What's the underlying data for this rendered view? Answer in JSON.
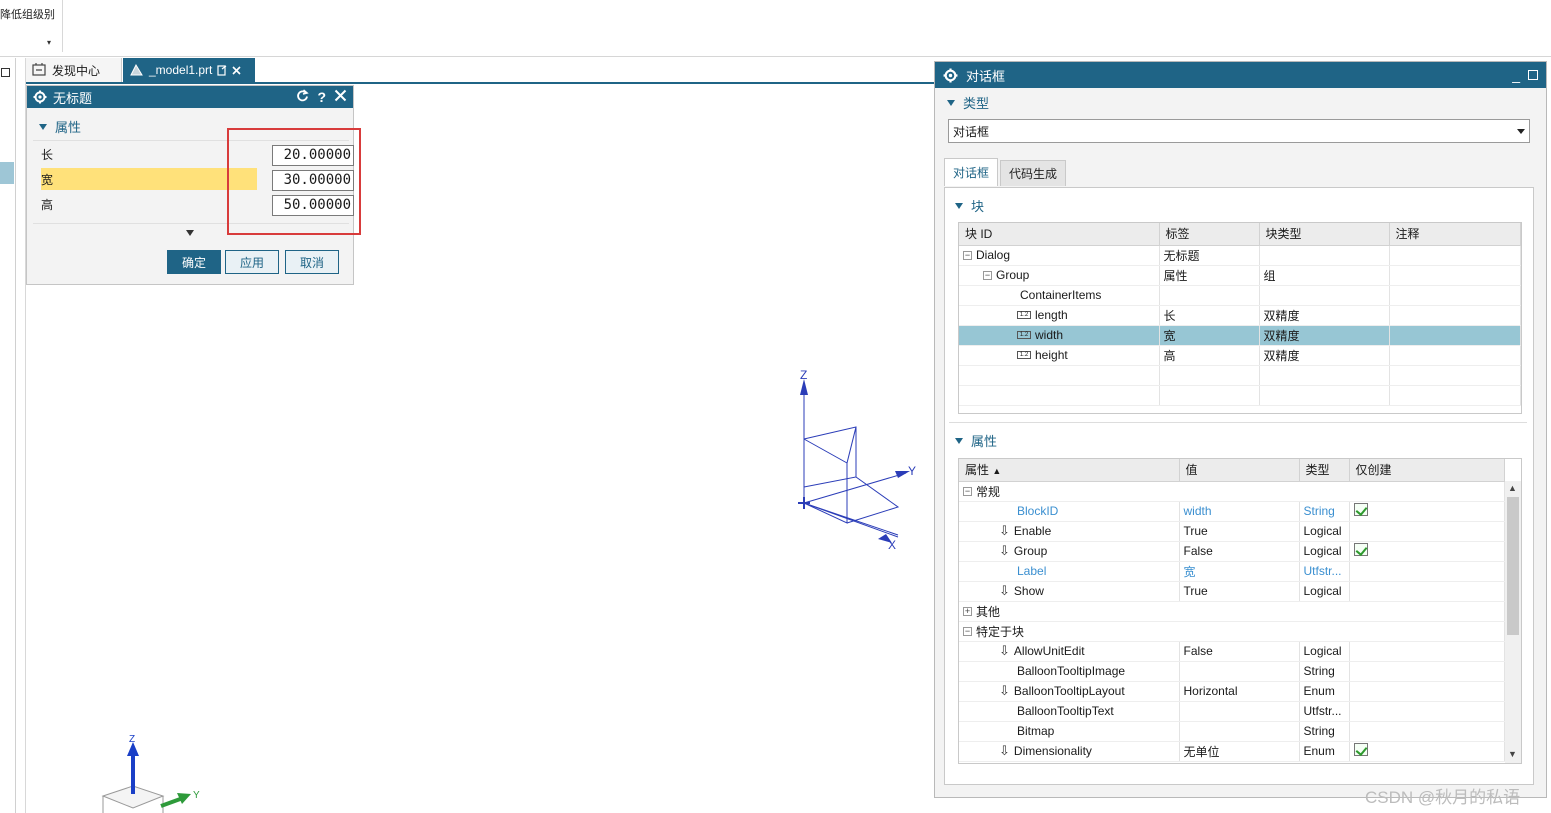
{
  "ribbon": {
    "command_label": "降低组级别",
    "dropdown_glyph": "▾"
  },
  "tabs": [
    {
      "label": "发现中心"
    },
    {
      "label": "_model1.prt"
    }
  ],
  "small_dialog": {
    "title": "无标题",
    "section": "属性",
    "rows": [
      {
        "label": "长",
        "value": "20.00000"
      },
      {
        "label": "宽",
        "value": "30.00000"
      },
      {
        "label": "高",
        "value": "50.00000"
      }
    ],
    "buttons": {
      "ok": "确定",
      "apply": "应用",
      "cancel": "取消"
    }
  },
  "big_dialog": {
    "title": "对话框",
    "type_section": "类型",
    "type_value": "对话框",
    "tabs": {
      "dialog": "对话框",
      "codegen": "代码生成"
    },
    "block_section": "块",
    "block_headers": {
      "id": "块 ID",
      "label": "标签",
      "type": "块类型",
      "note": "注释"
    },
    "block_rows": [
      {
        "id": "Dialog",
        "label": "无标题",
        "type": "",
        "note": ""
      },
      {
        "id": "Group",
        "label": "属性",
        "type": "组",
        "note": ""
      },
      {
        "id": "ContainerItems",
        "label": "",
        "type": "",
        "note": ""
      },
      {
        "id": "length",
        "label": "长",
        "type": "双精度",
        "note": ""
      },
      {
        "id": "width",
        "label": "宽",
        "type": "双精度",
        "note": ""
      },
      {
        "id": "height",
        "label": "高",
        "type": "双精度",
        "note": ""
      }
    ],
    "prop_section": "属性",
    "prop_headers": {
      "name": "属性",
      "value": "值",
      "type": "类型",
      "create_only": "仅创建"
    },
    "prop_groups": {
      "general": "常规",
      "other": "其他",
      "specific": "特定于块"
    },
    "prop_rows_general": [
      {
        "name": "BlockID",
        "value": "width",
        "type": "String"
      },
      {
        "name": "Enable",
        "value": "True",
        "type": "Logical"
      },
      {
        "name": "Group",
        "value": "False",
        "type": "Logical"
      },
      {
        "name": "Label",
        "value": "宽",
        "type": "Utfstr..."
      },
      {
        "name": "Show",
        "value": "True",
        "type": "Logical"
      }
    ],
    "prop_rows_specific": [
      {
        "name": "AllowUnitEdit",
        "value": "False",
        "type": "Logical"
      },
      {
        "name": "BalloonTooltipImage",
        "value": "",
        "type": "String"
      },
      {
        "name": "BalloonTooltipLayout",
        "value": "Horizontal",
        "type": "Enum"
      },
      {
        "name": "BalloonTooltipText",
        "value": "",
        "type": "Utfstr..."
      },
      {
        "name": "Bitmap",
        "value": "",
        "type": "String"
      },
      {
        "name": "Dimensionality",
        "value": "无单位",
        "type": "Enum"
      }
    ]
  },
  "triad": {
    "x": "X",
    "y": "Y",
    "z": "Z"
  },
  "watermark": "CSDN @秋月的私语",
  "colors": {
    "accent": "#1f6486",
    "selection": "#97c6d4",
    "highlight": "#ffe17a",
    "alert": "#d83b3b"
  }
}
